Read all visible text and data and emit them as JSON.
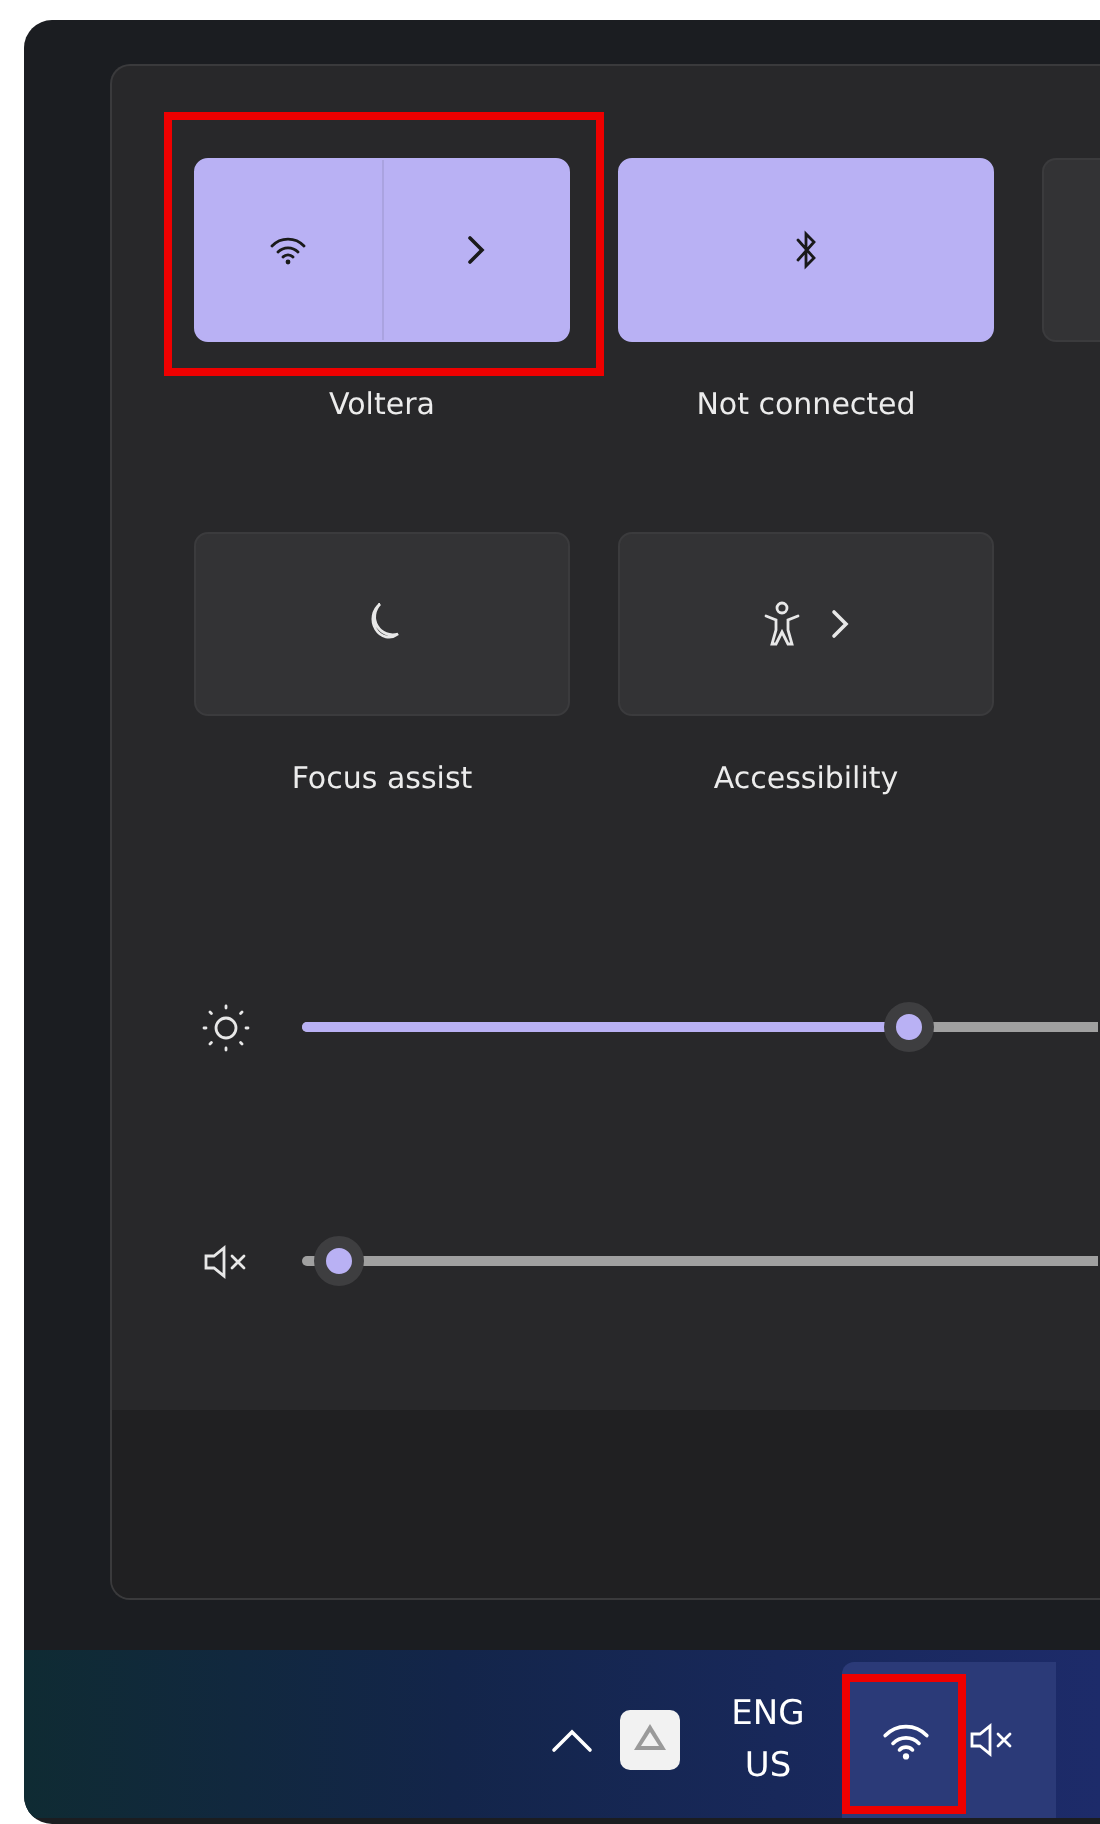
{
  "quick_settings": {
    "tiles": [
      {
        "kind": "wifi",
        "label": "Voltera",
        "on": true,
        "highlighted": true
      },
      {
        "kind": "bluetooth",
        "label": "Not connected",
        "on": true
      },
      {
        "kind": "blank",
        "on": false
      },
      {
        "kind": "focus",
        "label": "Focus assist",
        "on": false
      },
      {
        "kind": "accessibility",
        "label": "Accessibility",
        "on": false
      }
    ],
    "sliders": [
      {
        "kind": "brightness",
        "level": 0.75
      },
      {
        "kind": "volume",
        "muted": true,
        "level": 0
      }
    ]
  },
  "taskbar": {
    "tray": [
      {
        "kind": "chevron"
      },
      {
        "kind": "drive"
      },
      {
        "kind": "language",
        "lines": [
          "ENG",
          "US"
        ]
      }
    ],
    "system_button": {
      "hovered": true,
      "highlighted": true,
      "muted": true
    }
  }
}
